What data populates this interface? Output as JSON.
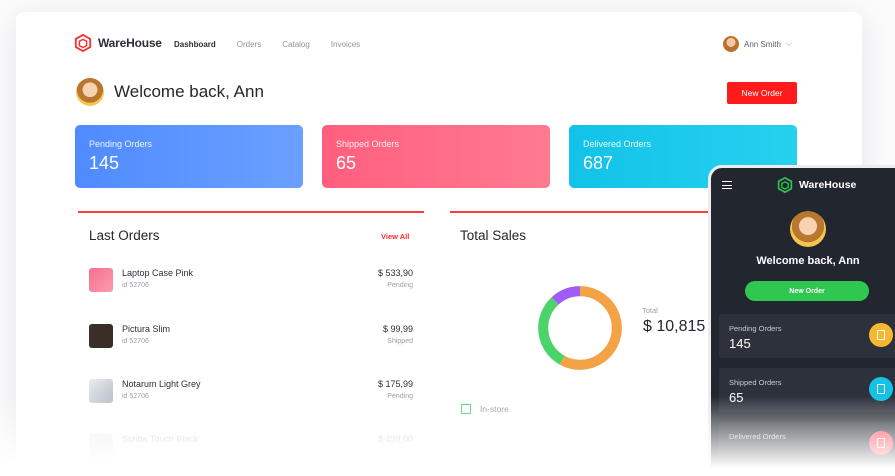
{
  "app": {
    "name": "WareHouse"
  },
  "nav": {
    "items": [
      {
        "label": "Dashboard",
        "active": true
      },
      {
        "label": "Orders",
        "active": false
      },
      {
        "label": "Catalog",
        "active": false
      },
      {
        "label": "Invoices",
        "active": false
      }
    ]
  },
  "user": {
    "name": "Ann Smith"
  },
  "welcome": {
    "text": "Welcome back, Ann"
  },
  "actions": {
    "new_order": "New Order"
  },
  "stats": [
    {
      "label": "Pending Orders",
      "value": "145",
      "color": "#4f8bff"
    },
    {
      "label": "Shipped Orders",
      "value": "65",
      "color": "#ff5f7e"
    },
    {
      "label": "Delivered Orders",
      "value": "687",
      "color": "#12c2e8"
    }
  ],
  "last_orders": {
    "title": "Last Orders",
    "view_all": "View All",
    "items": [
      {
        "name": "Laptop Case Pink",
        "id": "id 52706",
        "amount": "$ 533,90",
        "status": "Pending"
      },
      {
        "name": "Pictura Slim",
        "id": "id 52706",
        "amount": "$ 99,99",
        "status": "Shipped"
      },
      {
        "name": "Notarum Light Grey",
        "id": "id 52706",
        "amount": "$ 175,99",
        "status": "Pending"
      },
      {
        "name": "Scriba Touch Black",
        "id": "",
        "amount": "$ 499,00",
        "status": ""
      }
    ]
  },
  "total_sales": {
    "title": "Total Sales",
    "total_label": "Total",
    "total_value": "$ 10,815",
    "legend": [
      {
        "label": "In-store",
        "color": "#4cd36a"
      }
    ],
    "segments": [
      {
        "fraction": 0.58,
        "color": "#f2a346"
      },
      {
        "fraction": 0.3,
        "color": "#4cd36a"
      },
      {
        "fraction": 0.12,
        "color": "#a05cf5"
      }
    ]
  },
  "mobile": {
    "app_name": "WareHouse",
    "welcome": "Welcome back, Ann",
    "new_order": "New Order",
    "stats": [
      {
        "label": "Pending Orders",
        "value": "145",
        "icon": "clipboard-icon",
        "color": "#f7b731"
      },
      {
        "label": "Shipped Orders",
        "value": "65",
        "icon": "truck-icon",
        "color": "#16c1e8"
      },
      {
        "label": "Delivered Orders",
        "value": "",
        "icon": "check-icon",
        "color": "#ff4b5c"
      }
    ]
  }
}
